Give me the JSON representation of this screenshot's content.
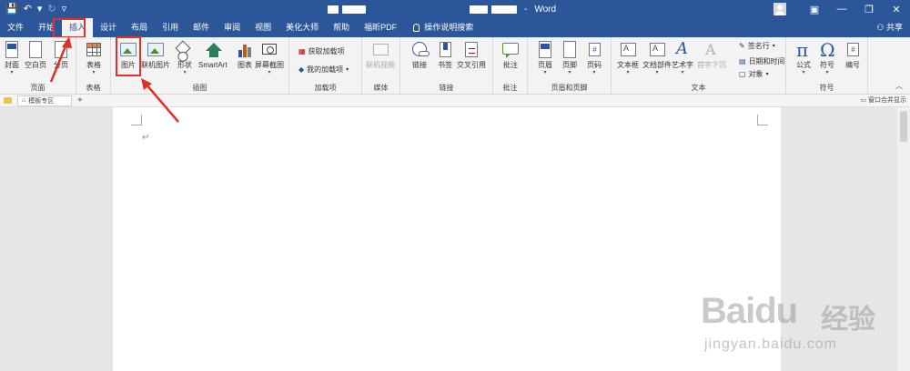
{
  "titlebar": {
    "qat": {
      "save": "💾",
      "undo": "↶",
      "undo_dd": "▾",
      "redo": "↻",
      "customize": "▿"
    },
    "doc_name_blurred": [
      "",
      "",
      "",
      ""
    ],
    "separator": "-",
    "app_name": "Word",
    "window_controls": {
      "ribbon_options": "▣",
      "minimize": "—",
      "restore": "❐",
      "close": "✕"
    }
  },
  "tabs": [
    "文件",
    "开始",
    "插入",
    "设计",
    "布局",
    "引用",
    "邮件",
    "审阅",
    "视图",
    "美化大师",
    "帮助",
    "福昕PDF"
  ],
  "active_tab": "插入",
  "search_label": "操作说明搜索",
  "share_label": "共享",
  "ribbon": {
    "groups": {
      "pages": "页面",
      "tables": "表格",
      "illustrations": "插图",
      "addins": "加载项",
      "media": "媒体",
      "links": "链接",
      "comments": "批注",
      "header_footer": "页眉和页脚",
      "text": "文本",
      "symbols": "符号"
    },
    "buttons": {
      "cover": "封面",
      "blank": "空白页",
      "page_break": "分页",
      "table": "表格",
      "picture": "图片",
      "online_picture": "联机图片",
      "shapes": "形状",
      "smartart": "SmartArt",
      "chart": "图表",
      "screenshot": "屏幕截图",
      "get_addins": "获取加载项",
      "my_addins": "我的加载项",
      "online_video": "联机视频",
      "link": "链接",
      "bookmark": "书签",
      "cross_ref": "交叉引用",
      "comment": "批注",
      "header": "页眉",
      "footer": "页脚",
      "page_number": "页码",
      "textbox": "文本框",
      "quick_parts": "文档部件",
      "wordart": "艺术字",
      "dropcap": "首字下沉",
      "signature": "签名行",
      "datetime": "日期和时间",
      "object": "对象",
      "equation": "公式",
      "symbol": "符号",
      "numbering": "编号"
    }
  },
  "docbar": {
    "tab_label": "模板专区",
    "add": "+",
    "right_label": "窗口合并显示"
  },
  "document": {
    "paragraph_mark": "↵"
  },
  "watermark": {
    "brand": "Baidu",
    "cn": "经验",
    "url": "jingyan.baidu.com"
  }
}
